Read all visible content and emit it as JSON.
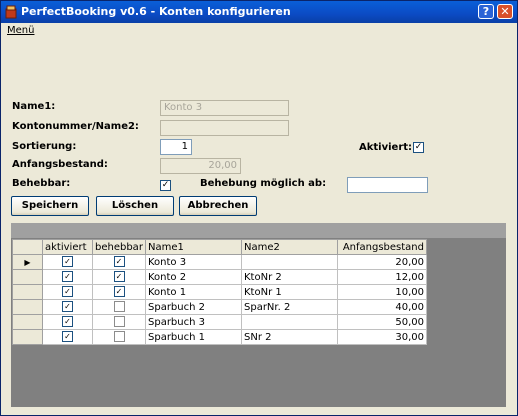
{
  "window": {
    "title": "PerfectBooking v0.6 - Konten konfigurieren",
    "help": "?",
    "close": "✕"
  },
  "menu": {
    "label": "Menü"
  },
  "form": {
    "name1_label": "Name1:",
    "name1_value": "Konto 3",
    "kontonummer_label": "Kontonummer/Name2:",
    "kontonummer_value": "",
    "sortierung_label": "Sortierung:",
    "sortierung_value": "1",
    "anfangsbestand_label": "Anfangsbestand:",
    "anfangsbestand_value": "20,00",
    "behebbar_label": "Behebbar:",
    "behebbar_checked": true,
    "aktiviert_label": "Aktiviert:",
    "aktiviert_checked": true,
    "behebung_label": "Behebung möglich ab:",
    "behebung_value": ""
  },
  "buttons": {
    "save": "Speichern",
    "delete": "Löschen",
    "cancel": "Abbrechen"
  },
  "grid": {
    "columns": [
      "aktiviert",
      "behebbar",
      "Name1",
      "Name2",
      "Anfangsbestand"
    ],
    "rows": [
      {
        "aktiviert": true,
        "behebbar": true,
        "name1": "Konto 3",
        "name2": "",
        "anfangsbestand": "20,00"
      },
      {
        "aktiviert": true,
        "behebbar": true,
        "name1": "Konto 2",
        "name2": "KtoNr 2",
        "anfangsbestand": "12,00"
      },
      {
        "aktiviert": true,
        "behebbar": true,
        "name1": "Konto 1",
        "name2": "KtoNr 1",
        "anfangsbestand": "10,00"
      },
      {
        "aktiviert": true,
        "behebbar": false,
        "name1": "Sparbuch 2",
        "name2": "SparNr. 2",
        "anfangsbestand": "40,00"
      },
      {
        "aktiviert": true,
        "behebbar": false,
        "name1": "Sparbuch 3",
        "name2": "",
        "anfangsbestand": "50,00"
      },
      {
        "aktiviert": true,
        "behebbar": false,
        "name1": "Sparbuch 1",
        "name2": "SNr 2",
        "anfangsbestand": "30,00"
      }
    ],
    "current_row_marker": "▶"
  }
}
